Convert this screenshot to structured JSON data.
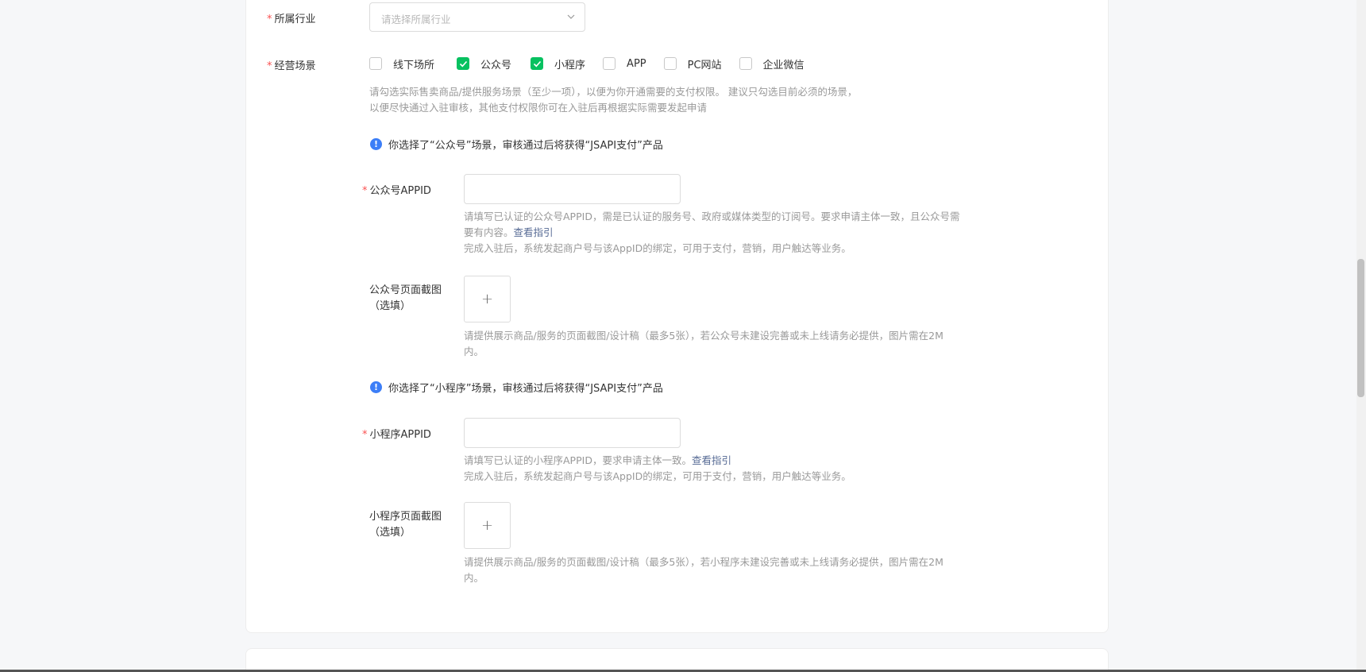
{
  "industry": {
    "label": "所属行业",
    "placeholder": "请选择所属行业"
  },
  "scenes": {
    "label": "经营场景",
    "options": [
      {
        "label": "线下场所",
        "checked": false
      },
      {
        "label": "公众号",
        "checked": true
      },
      {
        "label": "小程序",
        "checked": true
      },
      {
        "label": "APP",
        "checked": false
      },
      {
        "label": "PC网站",
        "checked": false
      },
      {
        "label": "企业微信",
        "checked": false
      }
    ],
    "hint_line1": "请勾选实际售卖商品/提供服务场景（至少一项），以便为你开通需要的支付权限。 建议只勾选目前必须的场景，",
    "hint_line2": "以便尽快通过入驻审核，其他支付权限你可在入驻后再根据实际需要发起申请"
  },
  "official_account": {
    "tip": "你选择了“公众号”场景，审核通过后将获得“JSAPI支付”产品",
    "appid_label": "公众号APPID",
    "appid_hint_line1": "请填写已认证的公众号APPID，需是已认证的服务号、政府或媒体类型的订阅号。要求申请主体一致，且公众号需",
    "appid_hint_line2": "要有内容。",
    "appid_guide_link": "查看指引",
    "appid_hint_line3": "完成入驻后，系统发起商户号与该AppID的绑定，可用于支付，营销，用户触达等业务。",
    "screenshot_label_line1": "公众号页面截图",
    "screenshot_label_line2": "（选填）",
    "upload_symbol": "+",
    "screenshot_hint_line1": "请提供展示商品/服务的页面截图/设计稿（最多5张），若公众号未建设完善或未上线请务必提供，图片需在2M",
    "screenshot_hint_line2": "内。"
  },
  "mini_program": {
    "tip": "你选择了“小程序”场景，审核通过后将获得“JSAPI支付”产品",
    "appid_label": "小程序APPID",
    "appid_hint_line1": "请填写已认证的小程序APPID，要求申请主体一致。",
    "appid_guide_link": "查看指引",
    "appid_hint_line2": "完成入驻后，系统发起商户号与该AppID的绑定，可用于支付，营销，用户触达等业务。",
    "screenshot_label_line1": "小程序页面截图",
    "screenshot_label_line2": "（选填）",
    "upload_symbol": "+",
    "screenshot_hint_line1": "请提供展示商品/服务的页面截图/设计稿（最多5张），若小程序未建设完善或未上线请务必提供，图片需在2M",
    "screenshot_hint_line2": "内。"
  },
  "colors": {
    "required": "#fa5151",
    "checked": "#07c160",
    "link": "#576b95",
    "info_icon": "#3c7ef7"
  },
  "icons": {
    "info": "!",
    "required": "*"
  }
}
